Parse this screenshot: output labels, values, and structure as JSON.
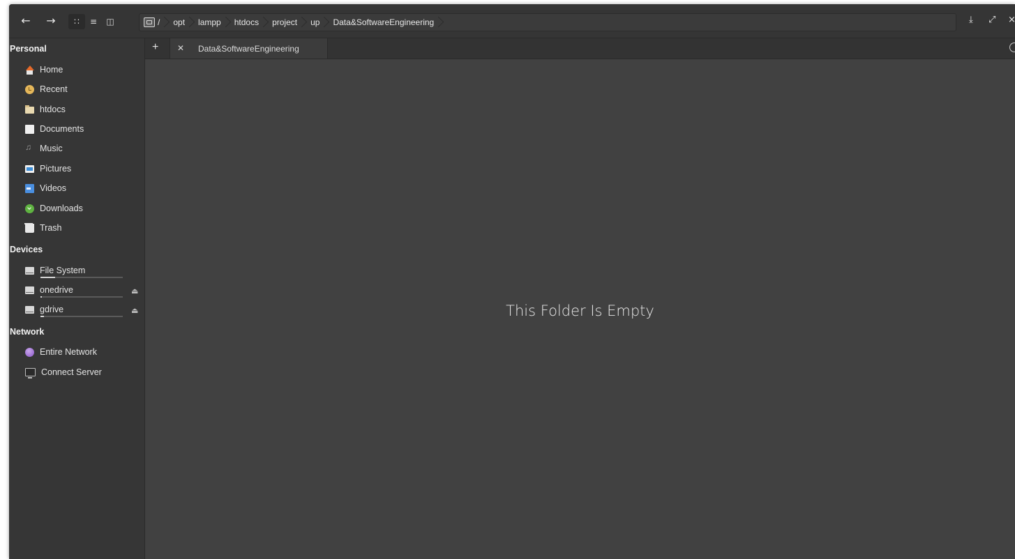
{
  "headerbar": {
    "back_icon": "back-arrow-icon",
    "forward_icon": "forward-arrow-icon",
    "view_modes": [
      "grid-view-icon",
      "list-view-icon",
      "column-view-icon"
    ],
    "breadcrumbs": [
      {
        "label": "/",
        "icon": "drive-icon"
      },
      {
        "label": "opt"
      },
      {
        "label": "lampp"
      },
      {
        "label": "htdocs"
      },
      {
        "label": "project"
      },
      {
        "label": "up"
      },
      {
        "label": "Data&SoftwareEngineering"
      }
    ],
    "window_buttons": [
      "minimize-icon",
      "maximize-icon",
      "close-icon"
    ]
  },
  "sidebar": {
    "personal_title": "Personal",
    "personal": [
      {
        "label": "Home",
        "icon": "home-icon"
      },
      {
        "label": "Recent",
        "icon": "recent-icon"
      },
      {
        "label": "htdocs",
        "icon": "folder-icon"
      },
      {
        "label": "Documents",
        "icon": "documents-icon"
      },
      {
        "label": "Music",
        "icon": "music-icon"
      },
      {
        "label": "Pictures",
        "icon": "pictures-icon"
      },
      {
        "label": "Videos",
        "icon": "videos-icon"
      },
      {
        "label": "Downloads",
        "icon": "downloads-icon"
      },
      {
        "label": "Trash",
        "icon": "trash-icon"
      }
    ],
    "devices_title": "Devices",
    "devices": [
      {
        "label": "File System",
        "icon": "drive-icon",
        "usage_fraction": 0.18
      },
      {
        "label": "onedrive",
        "icon": "drive-icon",
        "usage_fraction": 0.02
      },
      {
        "label": "gdrive",
        "icon": "drive-icon",
        "usage_fraction": 0.04
      }
    ],
    "network_title": "Network",
    "network": [
      {
        "label": "Entire Network",
        "icon": "network-icon"
      },
      {
        "label": "Connect Server",
        "icon": "server-icon"
      }
    ]
  },
  "tabs": {
    "add_icon": "add-tab-icon",
    "items": [
      {
        "label": "Data&SoftwareEngineering",
        "close_icon": "close-tab-icon"
      }
    ],
    "restore_icon": "restore-tab-icon"
  },
  "content": {
    "empty_message": "This Folder Is Empty"
  }
}
